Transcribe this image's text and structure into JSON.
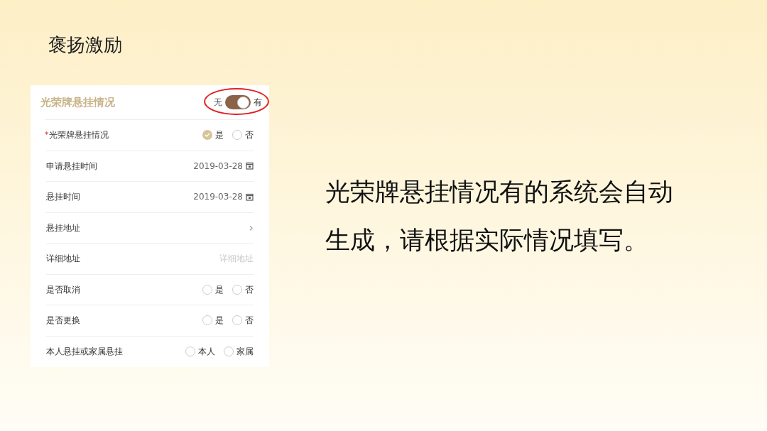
{
  "slide_title": "褒扬激励",
  "form": {
    "title": "光荣牌悬挂情况",
    "toggle": {
      "off_label": "无",
      "on_label": "有",
      "on": true,
      "highlighted": true
    },
    "rows": [
      {
        "kind": "radio",
        "required_mark": "*",
        "label": "光荣牌悬挂情况",
        "options": [
          {
            "label": "是",
            "selected": true
          },
          {
            "label": "否",
            "selected": false
          }
        ]
      },
      {
        "kind": "date",
        "label": "申请悬挂时间",
        "value": "2019-03-28"
      },
      {
        "kind": "date",
        "label": "悬挂时间",
        "value": "2019-03-28"
      },
      {
        "kind": "link",
        "label": "悬挂地址",
        "chevron": "›"
      },
      {
        "kind": "text",
        "label": "详细地址",
        "placeholder": "详细地址"
      },
      {
        "kind": "radio",
        "label": "是否取消",
        "options": [
          {
            "label": "是",
            "selected": false
          },
          {
            "label": "否",
            "selected": false
          }
        ]
      },
      {
        "kind": "radio",
        "label": "是否更换",
        "options": [
          {
            "label": "是",
            "selected": false
          },
          {
            "label": "否",
            "selected": false
          }
        ]
      },
      {
        "kind": "radio",
        "label": "本人悬挂或家属悬挂",
        "options": [
          {
            "label": "本人",
            "selected": false
          },
          {
            "label": "家属",
            "selected": false
          }
        ]
      }
    ]
  },
  "caption": "光荣牌悬挂情况有的系统会自动生成，请根据实际情况填写。"
}
